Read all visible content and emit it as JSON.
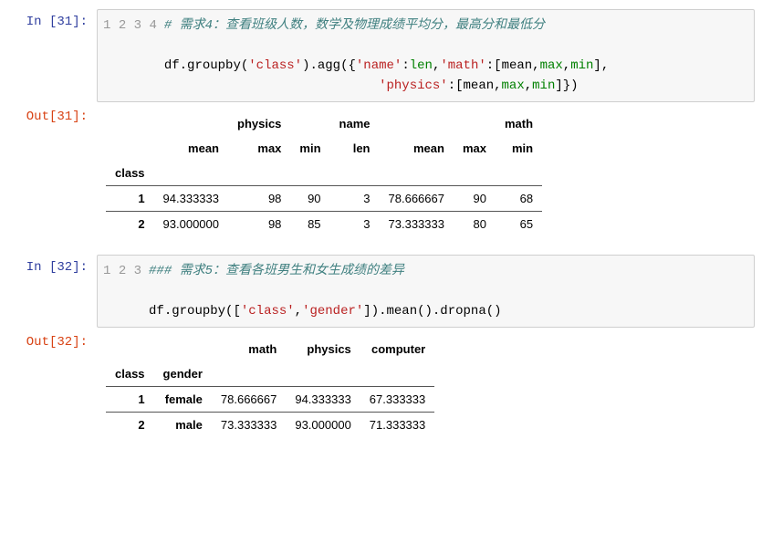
{
  "cells": {
    "c31": {
      "in_label": "In  [31]:",
      "out_label": "Out[31]:",
      "gutter": [
        "1",
        "2",
        "3",
        "4"
      ],
      "code": {
        "l1_comment": "# 需求4：查看班级人数，数学及物理成绩平均分，最高分和最低分",
        "l2": "",
        "l3_a": "df.groupby(",
        "l3_s1": "'class'",
        "l3_b": ").agg({",
        "l3_s2": "'name'",
        "l3_c": ":",
        "l3_len": "len",
        "l3_d": ",",
        "l3_s3": "'math'",
        "l3_e": ":[mean,",
        "l3_max": "max",
        "l3_f": ",",
        "l3_min": "min",
        "l3_g": "],",
        "l4_pad": "                            ",
        "l4_s4": "'physics'",
        "l4_a": ":[mean,",
        "l4_max": "max",
        "l4_b": ",",
        "l4_min": "min",
        "l4_c": "]})"
      },
      "table": {
        "top": {
          "physics": "physics",
          "name": "name",
          "math": "math"
        },
        "sub": {
          "mean": "mean",
          "max": "max",
          "min": "min",
          "len": "len"
        },
        "index_name": "class",
        "rows": [
          {
            "idx": "1",
            "phy_mean": "94.333333",
            "phy_max": "98",
            "phy_min": "90",
            "name_len": "3",
            "math_mean": "78.666667",
            "math_max": "90",
            "math_min": "68"
          },
          {
            "idx": "2",
            "phy_mean": "93.000000",
            "phy_max": "98",
            "phy_min": "85",
            "name_len": "3",
            "math_mean": "73.333333",
            "math_max": "80",
            "math_min": "65"
          }
        ]
      }
    },
    "c32": {
      "in_label": "In  [32]:",
      "out_label": "Out[32]:",
      "gutter": [
        "1",
        "2",
        "3"
      ],
      "code": {
        "l1_comment": "### 需求5：查看各班男生和女生成绩的差异",
        "l2": "",
        "l3_a": "df.groupby([",
        "l3_s1": "'class'",
        "l3_b": ",",
        "l3_s2": "'gender'",
        "l3_c": "]).mean().dropna()"
      },
      "table": {
        "cols": {
          "math": "math",
          "physics": "physics",
          "computer": "computer"
        },
        "index_names": {
          "class": "class",
          "gender": "gender"
        },
        "rows": [
          {
            "class": "1",
            "gender": "female",
            "math": "78.666667",
            "physics": "94.333333",
            "computer": "67.333333"
          },
          {
            "class": "2",
            "gender": "male",
            "math": "73.333333",
            "physics": "93.000000",
            "computer": "71.333333"
          }
        ]
      }
    }
  }
}
